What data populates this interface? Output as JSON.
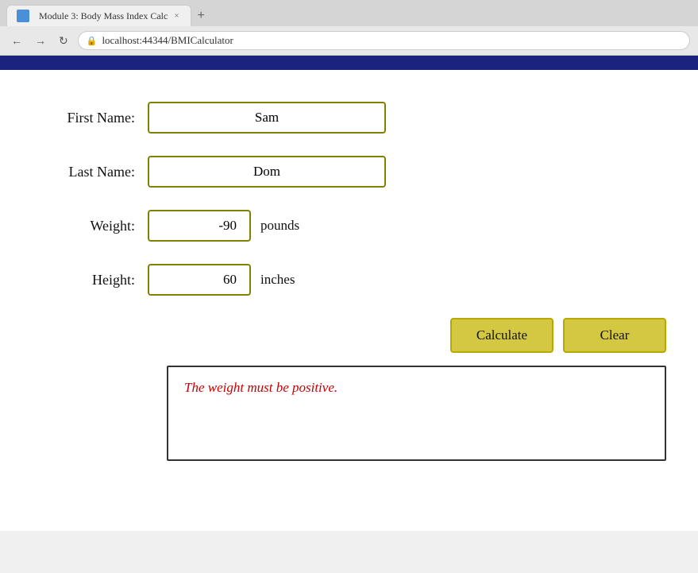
{
  "browser": {
    "tab_title": "Module 3: Body Mass Index Calc",
    "tab_close": "×",
    "tab_new": "+",
    "nav_back": "←",
    "nav_forward": "→",
    "nav_reload": "↻",
    "address": "localhost:44344/BMICalculator",
    "lock_icon": "🔒"
  },
  "form": {
    "first_name_label": "First Name:",
    "first_name_value": "Sam",
    "last_name_label": "Last Name:",
    "last_name_value": "Dom",
    "weight_label": "Weight:",
    "weight_value": "-90",
    "weight_unit": "pounds",
    "height_label": "Height:",
    "height_value": "60",
    "height_unit": "inches"
  },
  "buttons": {
    "calculate_label": "Calculate",
    "clear_label": "Clear"
  },
  "result": {
    "error_message": "The weight must be positive."
  }
}
